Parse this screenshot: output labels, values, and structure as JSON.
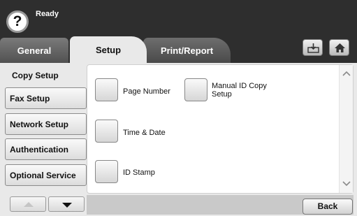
{
  "status": {
    "icon": "help-icon",
    "text": "Ready",
    "icon_glyph": "?"
  },
  "tabs": [
    {
      "label": "General"
    },
    {
      "label": "Setup"
    },
    {
      "label": "Print/Report"
    }
  ],
  "toolbar": {
    "download_icon": "download-tray-icon",
    "home_icon": "home-icon"
  },
  "sidebar": {
    "items": [
      {
        "label": "Copy Setup"
      },
      {
        "label": "Fax Setup"
      },
      {
        "label": "Network Setup"
      },
      {
        "label": "Authentication"
      },
      {
        "label": "Optional Service"
      }
    ]
  },
  "options": [
    {
      "label": "Page Number"
    },
    {
      "label": "Manual ID Copy Setup"
    },
    {
      "label": "Time & Date"
    },
    {
      "label": "ID Stamp"
    }
  ],
  "footer": {
    "back_label": "Back"
  }
}
